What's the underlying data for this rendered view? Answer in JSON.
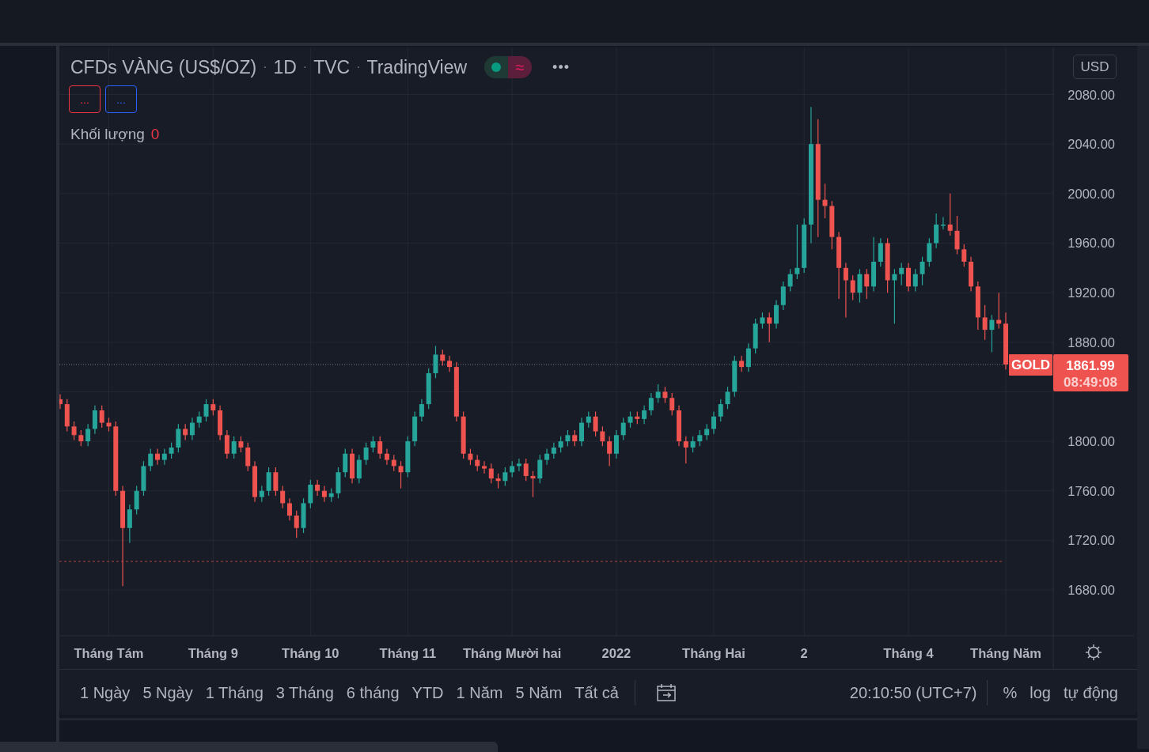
{
  "header": {
    "parts": [
      "CFDs VÀNG (US$/OZ)",
      "1D",
      "TVC",
      "TradingView"
    ],
    "separators": [
      "·",
      "·",
      "·"
    ],
    "status_symbol": "≈",
    "menu": "•••"
  },
  "legend_buttons": [
    {
      "label": "...",
      "color": "#f23645"
    },
    {
      "label": "...",
      "color": "#2962ff"
    }
  ],
  "volume": {
    "label": "Khối lượng",
    "value": "0"
  },
  "currency": "USD",
  "chart_data": {
    "type": "candlestick",
    "ylim": [
      1643,
      2118
    ],
    "grid": true,
    "yticks": [
      {
        "value": 1680,
        "label": "1680.00"
      },
      {
        "value": 1720,
        "label": "1720.00"
      },
      {
        "value": 1760,
        "label": "1760.00"
      },
      {
        "value": 1800,
        "label": "1800.00"
      },
      {
        "value": 1880,
        "label": "1880.00"
      },
      {
        "value": 1920,
        "label": "1920.00"
      },
      {
        "value": 1960,
        "label": "1960.00"
      },
      {
        "value": 2000,
        "label": "2000.00"
      },
      {
        "value": 2040,
        "label": "2040.00"
      },
      {
        "value": 2080,
        "label": "2080.00"
      }
    ],
    "categories": [
      null,
      null,
      null,
      null,
      null,
      null,
      null,
      "Tháng Tám",
      null,
      null,
      null,
      null,
      null,
      null,
      null,
      null,
      null,
      null,
      null,
      null,
      null,
      null,
      "Tháng 9",
      null,
      null,
      null,
      null,
      null,
      null,
      null,
      null,
      null,
      null,
      null,
      null,
      null,
      "Tháng 10",
      null,
      null,
      null,
      null,
      null,
      null,
      null,
      null,
      null,
      null,
      null,
      null,
      null,
      "Tháng 11",
      null,
      null,
      null,
      null,
      null,
      null,
      null,
      null,
      null,
      null,
      null,
      null,
      null,
      null,
      "Tháng Mười hai",
      null,
      null,
      null,
      null,
      null,
      null,
      null,
      null,
      null,
      null,
      null,
      null,
      null,
      null,
      "2022",
      null,
      null,
      null,
      null,
      null,
      null,
      null,
      null,
      null,
      null,
      null,
      null,
      null,
      "Tháng Hai",
      null,
      null,
      null,
      null,
      null,
      null,
      null,
      null,
      null,
      null,
      null,
      null,
      "2",
      null,
      null,
      null,
      null,
      null,
      null,
      null,
      null,
      null,
      null,
      null,
      null,
      null,
      null,
      "Tháng 4",
      null,
      null,
      null,
      null,
      null,
      null,
      null,
      null,
      null,
      null,
      null,
      null,
      null,
      "Tháng Năm"
    ],
    "ohlc": [
      [
        1834,
        1838,
        1826,
        1830
      ],
      [
        1830,
        1834,
        1808,
        1812
      ],
      [
        1812,
        1816,
        1801,
        1805
      ],
      [
        1805,
        1809,
        1796,
        1800
      ],
      [
        1800,
        1814,
        1796,
        1810
      ],
      [
        1810,
        1829,
        1806,
        1825
      ],
      [
        1825,
        1829,
        1811,
        1815
      ],
      [
        1815,
        1819,
        1808,
        1812
      ],
      [
        1812,
        1816,
        1756,
        1760
      ],
      [
        1760,
        1764,
        1683,
        1730
      ],
      [
        1730,
        1749,
        1718,
        1745
      ],
      [
        1745,
        1764,
        1741,
        1760
      ],
      [
        1760,
        1784,
        1756,
        1780
      ],
      [
        1780,
        1794,
        1776,
        1790
      ],
      [
        1790,
        1794,
        1781,
        1785
      ],
      [
        1785,
        1794,
        1781,
        1790
      ],
      [
        1790,
        1799,
        1786,
        1795
      ],
      [
        1795,
        1814,
        1791,
        1810
      ],
      [
        1810,
        1814,
        1801,
        1805
      ],
      [
        1805,
        1819,
        1801,
        1815
      ],
      [
        1815,
        1824,
        1811,
        1820
      ],
      [
        1820,
        1834,
        1816,
        1830
      ],
      [
        1830,
        1834,
        1821,
        1825
      ],
      [
        1825,
        1829,
        1801,
        1805
      ],
      [
        1805,
        1809,
        1786,
        1790
      ],
      [
        1790,
        1804,
        1786,
        1800
      ],
      [
        1800,
        1804,
        1791,
        1795
      ],
      [
        1795,
        1799,
        1776,
        1780
      ],
      [
        1780,
        1784,
        1751,
        1755
      ],
      [
        1755,
        1764,
        1751,
        1760
      ],
      [
        1760,
        1779,
        1756,
        1775
      ],
      [
        1775,
        1779,
        1756,
        1760
      ],
      [
        1760,
        1764,
        1746,
        1750
      ],
      [
        1750,
        1754,
        1736,
        1740
      ],
      [
        1740,
        1744,
        1722,
        1730
      ],
      [
        1730,
        1754,
        1726,
        1750
      ],
      [
        1750,
        1769,
        1746,
        1765
      ],
      [
        1765,
        1769,
        1756,
        1760
      ],
      [
        1760,
        1764,
        1751,
        1755
      ],
      [
        1755,
        1762,
        1751,
        1758
      ],
      [
        1758,
        1779,
        1754,
        1775
      ],
      [
        1775,
        1794,
        1771,
        1790
      ],
      [
        1790,
        1794,
        1766,
        1770
      ],
      [
        1770,
        1789,
        1766,
        1785
      ],
      [
        1785,
        1799,
        1781,
        1795
      ],
      [
        1795,
        1804,
        1791,
        1800
      ],
      [
        1800,
        1804,
        1786,
        1790
      ],
      [
        1790,
        1794,
        1781,
        1785
      ],
      [
        1785,
        1789,
        1776,
        1780
      ],
      [
        1780,
        1784,
        1762,
        1775
      ],
      [
        1775,
        1804,
        1771,
        1800
      ],
      [
        1800,
        1824,
        1796,
        1820
      ],
      [
        1820,
        1834,
        1816,
        1830
      ],
      [
        1830,
        1859,
        1826,
        1855
      ],
      [
        1855,
        1877,
        1851,
        1870
      ],
      [
        1870,
        1874,
        1861,
        1865
      ],
      [
        1865,
        1869,
        1856,
        1860
      ],
      [
        1860,
        1864,
        1816,
        1820
      ],
      [
        1820,
        1824,
        1786,
        1790
      ],
      [
        1790,
        1794,
        1781,
        1785
      ],
      [
        1785,
        1789,
        1776,
        1780
      ],
      [
        1780,
        1784,
        1774,
        1778
      ],
      [
        1778,
        1782,
        1766,
        1770
      ],
      [
        1770,
        1774,
        1762,
        1768
      ],
      [
        1768,
        1779,
        1764,
        1775
      ],
      [
        1775,
        1784,
        1771,
        1780
      ],
      [
        1780,
        1786,
        1776,
        1782
      ],
      [
        1782,
        1786,
        1768,
        1772
      ],
      [
        1772,
        1776,
        1755,
        1770
      ],
      [
        1770,
        1789,
        1766,
        1785
      ],
      [
        1785,
        1794,
        1781,
        1790
      ],
      [
        1790,
        1799,
        1786,
        1795
      ],
      [
        1795,
        1804,
        1791,
        1800
      ],
      [
        1800,
        1809,
        1796,
        1805
      ],
      [
        1805,
        1809,
        1796,
        1800
      ],
      [
        1800,
        1819,
        1796,
        1815
      ],
      [
        1815,
        1824,
        1811,
        1820
      ],
      [
        1820,
        1824,
        1804,
        1808
      ],
      [
        1808,
        1812,
        1796,
        1800
      ],
      [
        1800,
        1804,
        1780,
        1790
      ],
      [
        1790,
        1809,
        1786,
        1805
      ],
      [
        1805,
        1819,
        1801,
        1815
      ],
      [
        1815,
        1824,
        1811,
        1820
      ],
      [
        1820,
        1824,
        1814,
        1818
      ],
      [
        1818,
        1829,
        1814,
        1825
      ],
      [
        1825,
        1839,
        1821,
        1835
      ],
      [
        1835,
        1846,
        1831,
        1840
      ],
      [
        1840,
        1844,
        1831,
        1835
      ],
      [
        1835,
        1839,
        1821,
        1825
      ],
      [
        1825,
        1829,
        1796,
        1800
      ],
      [
        1800,
        1804,
        1782,
        1795
      ],
      [
        1795,
        1804,
        1791,
        1800
      ],
      [
        1800,
        1809,
        1796,
        1805
      ],
      [
        1805,
        1814,
        1801,
        1810
      ],
      [
        1810,
        1824,
        1806,
        1820
      ],
      [
        1820,
        1834,
        1816,
        1830
      ],
      [
        1830,
        1844,
        1826,
        1840
      ],
      [
        1840,
        1869,
        1836,
        1865
      ],
      [
        1865,
        1869,
        1856,
        1860
      ],
      [
        1860,
        1879,
        1856,
        1875
      ],
      [
        1875,
        1899,
        1871,
        1895
      ],
      [
        1895,
        1904,
        1891,
        1900
      ],
      [
        1900,
        1904,
        1880,
        1895
      ],
      [
        1895,
        1914,
        1891,
        1910
      ],
      [
        1910,
        1929,
        1906,
        1925
      ],
      [
        1925,
        1939,
        1921,
        1935
      ],
      [
        1935,
        1975,
        1931,
        1940
      ],
      [
        1940,
        1980,
        1936,
        1975
      ],
      [
        1975,
        2070,
        1960,
        2040
      ],
      [
        2040,
        2060,
        1965,
        1995
      ],
      [
        1995,
        2008,
        1980,
        1990
      ],
      [
        1990,
        1994,
        1955,
        1965
      ],
      [
        1965,
        1969,
        1915,
        1940
      ],
      [
        1940,
        1944,
        1900,
        1930
      ],
      [
        1930,
        1934,
        1914,
        1920
      ],
      [
        1920,
        1939,
        1912,
        1935
      ],
      [
        1935,
        1939,
        1915,
        1925
      ],
      [
        1925,
        1965,
        1921,
        1945
      ],
      [
        1945,
        1964,
        1941,
        1960
      ],
      [
        1960,
        1964,
        1920,
        1930
      ],
      [
        1930,
        1939,
        1895,
        1935
      ],
      [
        1935,
        1944,
        1926,
        1940
      ],
      [
        1940,
        1944,
        1921,
        1925
      ],
      [
        1925,
        1939,
        1921,
        1935
      ],
      [
        1935,
        1949,
        1926,
        1945
      ],
      [
        1945,
        1964,
        1941,
        1960
      ],
      [
        1960,
        1984,
        1956,
        1975
      ],
      [
        1975,
        1981,
        1971,
        1975
      ],
      [
        1975,
        2000,
        1966,
        1970
      ],
      [
        1970,
        1982,
        1951,
        1955
      ],
      [
        1955,
        1959,
        1941,
        1945
      ],
      [
        1945,
        1949,
        1921,
        1925
      ],
      [
        1925,
        1929,
        1890,
        1900
      ],
      [
        1900,
        1910,
        1882,
        1890
      ],
      [
        1890,
        1902,
        1872,
        1898
      ],
      [
        1898,
        1920,
        1891,
        1895
      ],
      [
        1895,
        1904,
        1858,
        1862
      ]
    ],
    "ref_lines": [
      {
        "axis": "y",
        "value": 1703,
        "color": "#b2453f"
      },
      {
        "axis": "y",
        "value": 1861.99,
        "color": "#787b86"
      }
    ]
  },
  "price_marker": {
    "symbol": "GOLD",
    "price": "1861.99",
    "countdown": "08:49:08"
  },
  "ranges": [
    "1 Ngày",
    "5 Ngày",
    "1 Tháng",
    "3 Tháng",
    "6 tháng",
    "YTD",
    "1 Năm",
    "5 Năm",
    "Tất cả"
  ],
  "clock": "20:10:50 (UTC+7)",
  "scale_buttons": [
    "%",
    "log",
    "tự động"
  ]
}
